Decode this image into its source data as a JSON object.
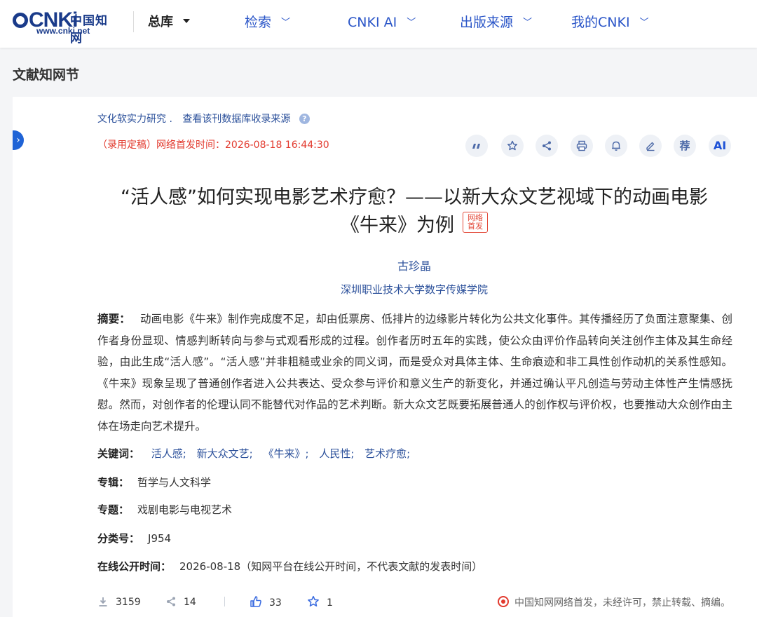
{
  "header": {
    "logo": {
      "mark": "CNKi",
      "cn": "中国知网",
      "url": "www.cnki.net"
    },
    "library": "总库",
    "nav": [
      "检索",
      "CNKI AI",
      "出版来源",
      "我的CNKI"
    ]
  },
  "section_title": "文献知网节",
  "source": {
    "journal": "文化软实力研究 .",
    "link": "查看该刊数据库收录来源"
  },
  "pub_info": "（录用定稿）网络首发时间：2026-08-18 16:44:30",
  "toolbar": {
    "recommend": "荐",
    "ai": "AI"
  },
  "article": {
    "title_line1": "“活人感”如何实现电影艺术疗愈？——以新大众文艺视域下的动画电影",
    "title_line2": "《牛来》为例",
    "first_badge": "网络首发",
    "author": "古珍晶",
    "org": "深圳职业技术大学数字传媒学院"
  },
  "abstract": {
    "label": "摘要：",
    "text": "动画电影《牛来》制作完成度不足，却由低票房、低排片的边缘影片转化为公共文化事件。其传播经历了负面注意聚集、创作者身份显现、情感判断转向与参与式观看形成的过程。创作者历时五年的实践，使公众由评价作品转向关注创作主体及其生命经验，由此生成“活人感”。“活人感”并非粗糙或业余的同义词，而是受众对具体主体、生命痕迹和非工具性创作动机的关系性感知。《牛来》现象呈现了普通创作者进入公共表达、受众参与评价和意义生产的新变化，并通过确认平凡创造与劳动主体性产生情感抚慰。然而，对创作者的伦理认同不能替代对作品的艺术判断。新大众文艺既要拓展普通人的创作权与评价权，也要推动大众创作由主体在场走向艺术提升。"
  },
  "keywords": {
    "label": "关键词：",
    "items": [
      "活人感;",
      "新大众文艺;",
      "《牛来》;",
      "人民性;",
      "艺术疗愈;"
    ]
  },
  "album": {
    "label": "专辑：",
    "value": "哲学与人文科学"
  },
  "topic": {
    "label": "专题：",
    "value": "戏剧电影与电视艺术"
  },
  "class_no": {
    "label": "分类号：",
    "value": "J954"
  },
  "online_time": {
    "label": "在线公开时间：",
    "value": "2026-08-18（知网平台在线公开时间，不代表文献的发表时间）"
  },
  "stats": {
    "downloads": "3159",
    "shares": "14",
    "likes": "33",
    "favorites": "1"
  },
  "notice": "中国知网网络首发，未经许可，禁止转载、摘编。"
}
